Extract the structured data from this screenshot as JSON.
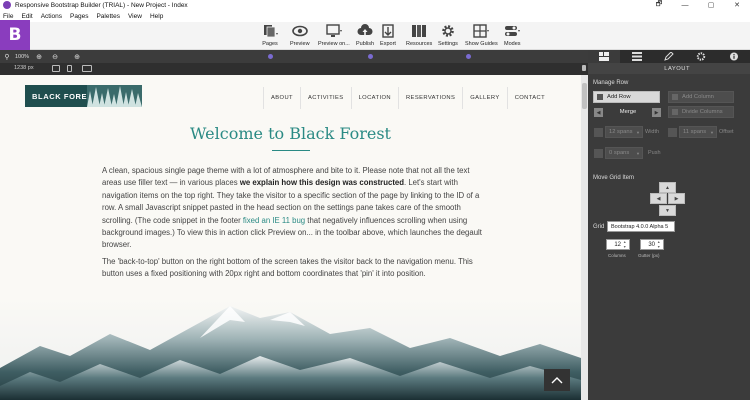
{
  "titlebar": {
    "title": "Responsive Bootstrap Builder (TRIAL) - New Project - Index",
    "controls": [
      "🗗",
      "—",
      "▢",
      "✕"
    ]
  },
  "menu": [
    "File",
    "Edit",
    "Actions",
    "Pages",
    "Palettes",
    "View",
    "Help"
  ],
  "toolbar": {
    "logo": "B",
    "tools": [
      {
        "label": "Pages",
        "icon": "pages-icon"
      },
      {
        "label": "Preview",
        "icon": "eye-icon"
      },
      {
        "label": "Preview on...",
        "icon": "monitor-icon"
      },
      {
        "label": "Publish",
        "icon": "cloud-upload-icon"
      },
      {
        "label": "Export",
        "icon": "export-icon"
      },
      {
        "label": "Resources",
        "icon": "books-icon"
      },
      {
        "label": "Settings",
        "icon": "gear-icon"
      },
      {
        "label": "Show Guides",
        "icon": "grid-icon"
      },
      {
        "label": "Modes",
        "icon": "toggles-icon"
      }
    ]
  },
  "zoombar": {
    "zoom": "100%",
    "width": "1238 px"
  },
  "site": {
    "brand": "BLACK FOREST",
    "nav": [
      "ABOUT",
      "ACTIVITIES",
      "LOCATION",
      "RESERVATIONS",
      "GALLERY",
      "CONTACT"
    ],
    "heading": "Welcome to Black Forest",
    "p1": {
      "a": "A clean, spacious single page theme with a lot of atmosphere and bite to it. Please note that not all the text areas use filler text — in various places ",
      "b": "we explain how this design was constructed",
      "c": ". Let's start with navigation items on the top right. They take the visitor to a specific section of the page by linking to the ID of a row. A small Javascript snippet pasted in the head section on the settings pane takes care of the smooth scrolling. (The code snippet in the footer ",
      "link": "fixed an IE 11 bug",
      "d": " that negatively influences scrolling when using background images.) To view this in action click Preview on... in the toolbar above, which launches the degault browser."
    },
    "p2": "The 'back-to-top' button on the right bottom of the screen takes the visitor back to the navigation menu. This button uses a fixed positioning with 20px right and bottom coordinates that 'pin' it into position."
  },
  "panel": {
    "section": "LAYOUT",
    "manage_row": "Manage Row",
    "add_row": "Add Row",
    "add_column": "Add Column",
    "merge": "Merge",
    "divide_columns": "Divide Columns",
    "spans_a": "12 spans",
    "width": "Width",
    "spans_b": "11 spans",
    "offset": "Offset",
    "spans_c": "0 spans",
    "push": "Push",
    "move_grid_item": "Move Grid Item",
    "grid_label": "Grid",
    "grid_value": "Bootstrap 4.0.0 Alpha 5",
    "columns_value": "12",
    "columns_label": "Columns",
    "gutter_value": "30",
    "gutter_label": "Gutter (px)"
  }
}
